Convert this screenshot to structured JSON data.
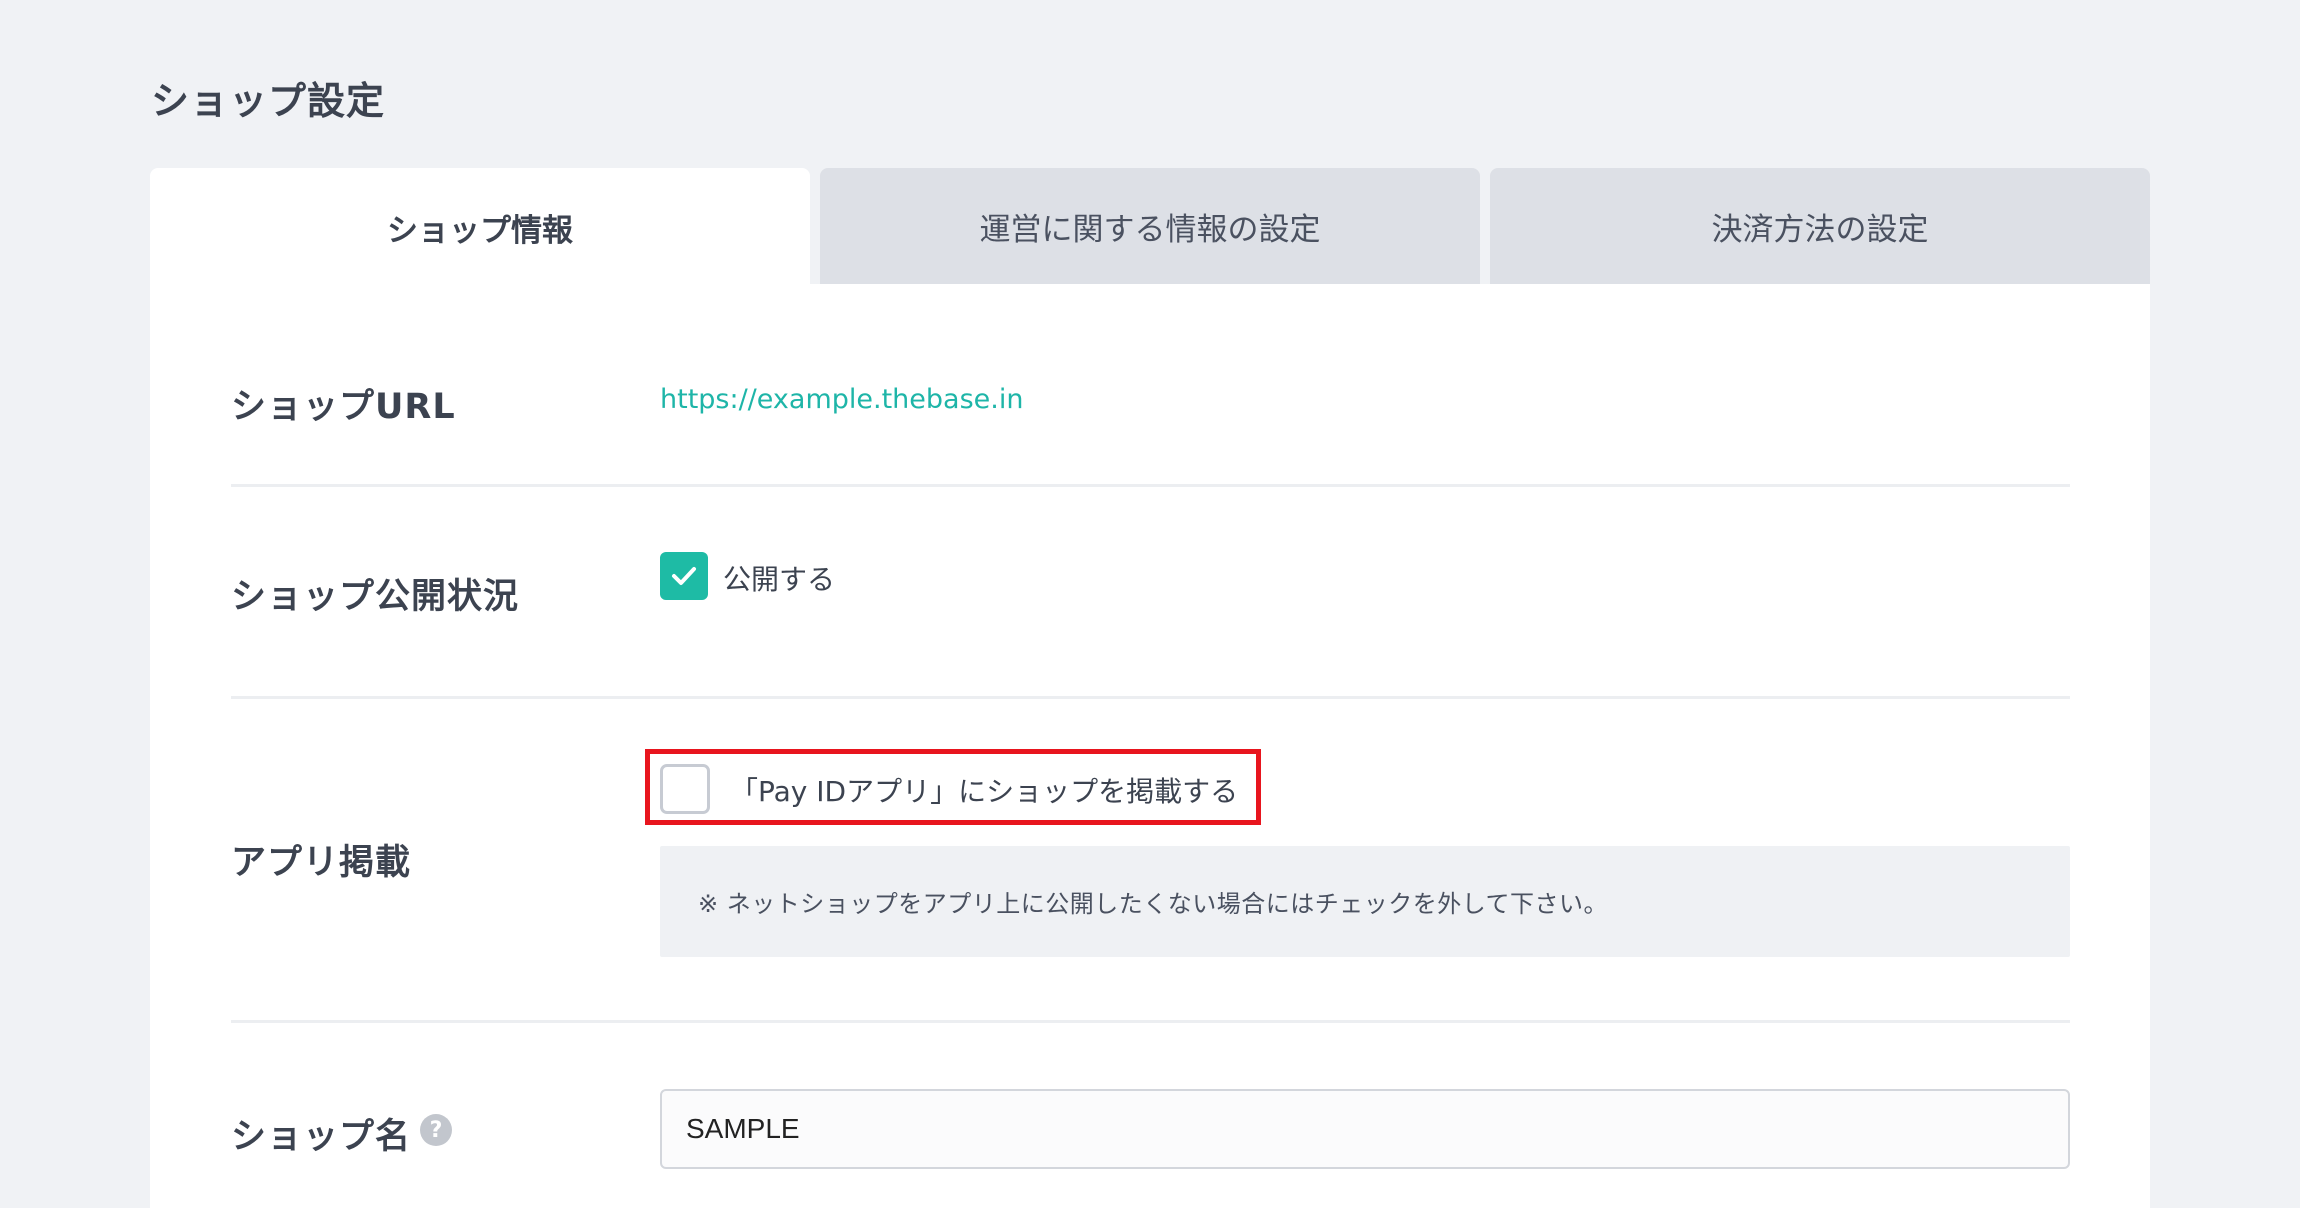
{
  "page": {
    "title": "ショップ設定"
  },
  "tabs": [
    {
      "label": "ショップ情報",
      "active": true
    },
    {
      "label": "運営に関する情報の設定",
      "active": false
    },
    {
      "label": "決済方法の設定",
      "active": false
    }
  ],
  "rows": {
    "shop_url": {
      "label": "ショップURL",
      "value": "https://example.thebase.in"
    },
    "publish_status": {
      "label": "ショップ公開状況",
      "checkbox_label": "公開する",
      "checked": true
    },
    "app_listing": {
      "label": "アプリ掲載",
      "checkbox_label": "「Pay IDアプリ」にショップを掲載する",
      "checked": false,
      "note": "※ ネットショップをアプリ上に公開したくない場合にはチェックを外して下さい。"
    },
    "shop_name": {
      "label": "ショップ名",
      "help_glyph": "?",
      "value": "SAMPLE"
    }
  },
  "colors": {
    "accent": "#1ebba5",
    "link": "#1eb5a8",
    "highlight": "#e8151e",
    "background": "#f0f2f5"
  },
  "icons": {
    "checkmark": "check-icon",
    "help": "question-circle-icon"
  }
}
